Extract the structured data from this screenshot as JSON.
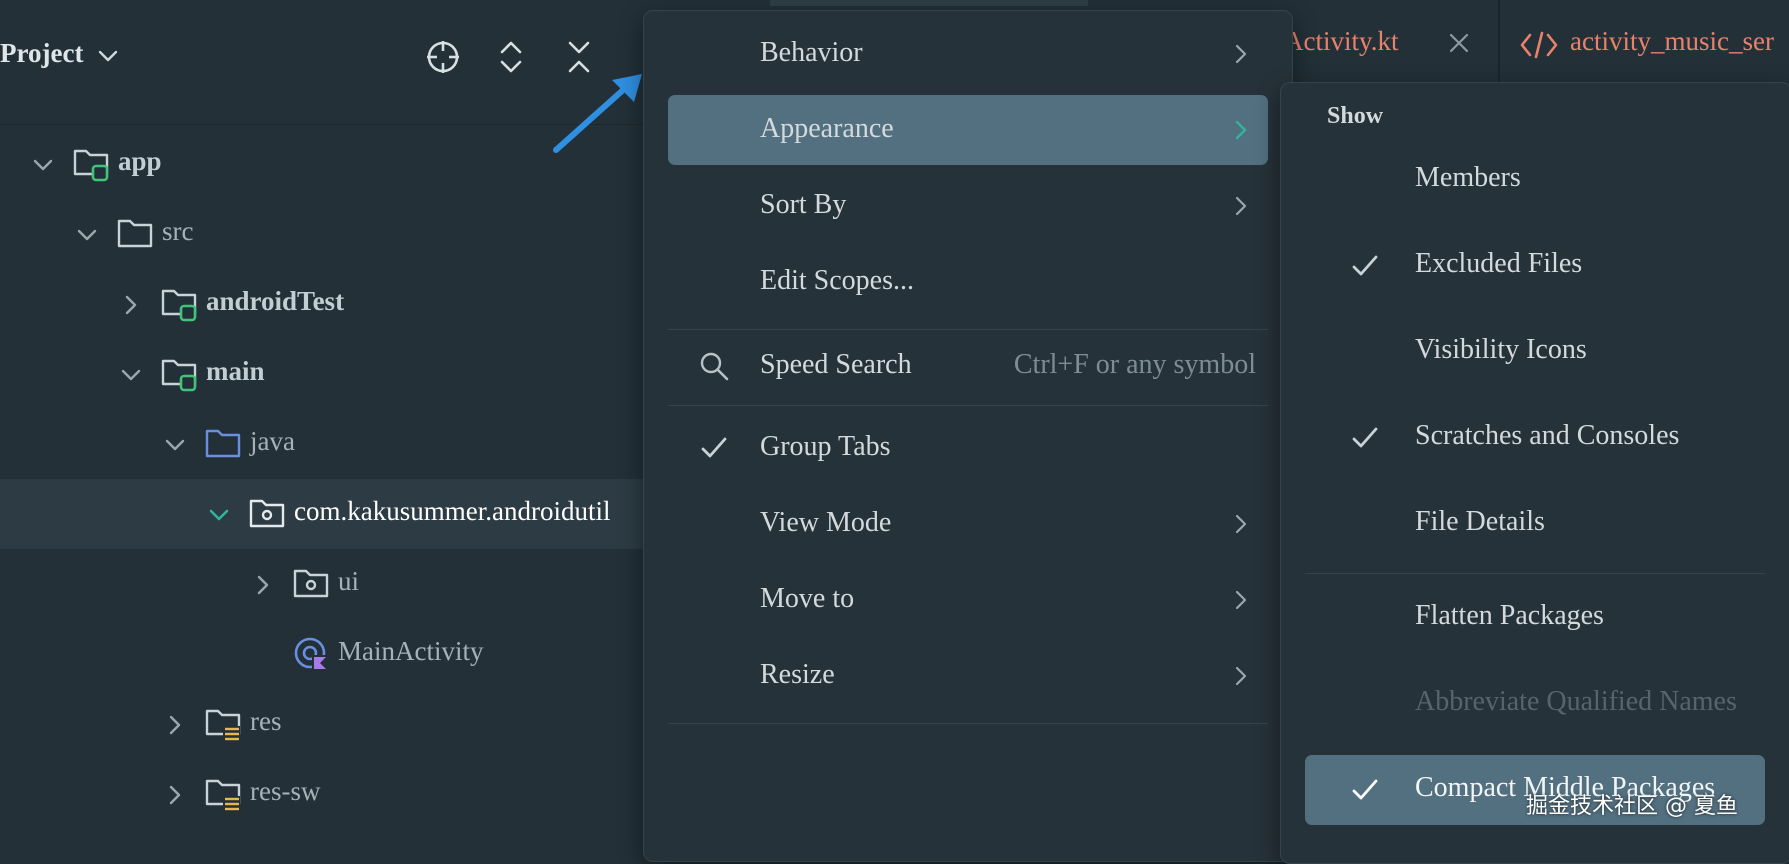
{
  "project_panel": {
    "title": "Project",
    "toolbar": {
      "locate_icon": "crosshair-icon",
      "expand_icon": "expand-all-icon",
      "collapse_icon": "collapse-all-icon"
    },
    "tree": [
      {
        "label": "app",
        "expanded": true,
        "icon": "module-folder-icon",
        "bold": true
      },
      {
        "label": "src",
        "expanded": true,
        "icon": "folder-icon",
        "bold": false
      },
      {
        "label": "androidTest",
        "expanded": false,
        "icon": "module-folder-icon",
        "bold": true
      },
      {
        "label": "main",
        "expanded": true,
        "icon": "module-folder-icon",
        "bold": true
      },
      {
        "label": "java",
        "expanded": true,
        "icon": "source-folder-icon",
        "bold": false
      },
      {
        "label": "com.kakusummer.androidutil",
        "expanded": true,
        "icon": "package-icon",
        "selected": true
      },
      {
        "label": "ui",
        "expanded": false,
        "icon": "package-icon"
      },
      {
        "label": "MainActivity",
        "icon": "kotlin-class-icon"
      },
      {
        "label": "res",
        "expanded": false,
        "icon": "resource-folder-icon"
      },
      {
        "label": "res-sw",
        "expanded": false,
        "icon": "resource-folder-icon"
      }
    ]
  },
  "editor_tabs": [
    {
      "label": "ceActivity.kt",
      "icon": "close-icon"
    },
    {
      "label": "activity_music_ser",
      "icon": "xml-layout-icon"
    }
  ],
  "context_menu": {
    "items": [
      {
        "label": "Behavior",
        "submenu": true
      },
      {
        "label": "Appearance",
        "submenu": true,
        "highlighted": true
      },
      {
        "label": "Sort By",
        "submenu": true
      },
      {
        "label": "Edit Scopes...",
        "submenu": false
      },
      {
        "label": "Speed Search",
        "shortcut": "Ctrl+F or any symbol",
        "icon": "search-icon"
      },
      {
        "label": "Group Tabs",
        "checked": true
      },
      {
        "label": "View Mode",
        "submenu": true
      },
      {
        "label": "Move to",
        "submenu": true
      },
      {
        "label": "Resize",
        "submenu": true
      }
    ]
  },
  "appearance_submenu": {
    "header": "Show",
    "items": [
      {
        "label": "Members",
        "checked": false
      },
      {
        "label": "Excluded Files",
        "checked": true
      },
      {
        "label": "Visibility Icons",
        "checked": false
      },
      {
        "label": "Scratches and Consoles",
        "checked": true
      },
      {
        "label": "File Details",
        "checked": false
      },
      {
        "label": "Flatten Packages",
        "checked": false
      },
      {
        "label": "Abbreviate Qualified Names",
        "checked": false,
        "disabled": true
      },
      {
        "label": "Compact Middle Packages",
        "checked": true,
        "highlighted": true
      }
    ]
  },
  "watermark": "掘金技术社区 @ 夏鱼",
  "colors": {
    "background": "#233038",
    "menu_bg": "#263239",
    "highlight": "#537080",
    "module_badge": "#3fc47a",
    "source_folder": "#6b8ee0",
    "tab_text": "#e8826a",
    "pointer_arrow": "#2f8fe0"
  }
}
